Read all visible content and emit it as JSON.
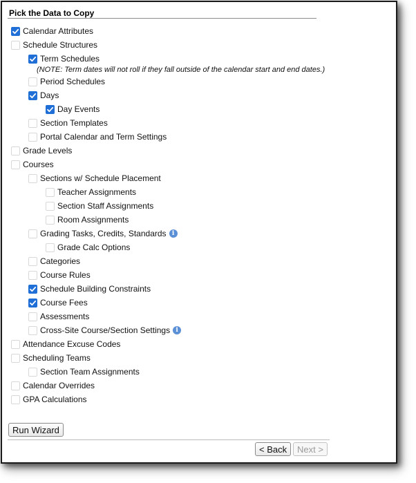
{
  "section_title": "Pick the Data to Copy",
  "items": [
    {
      "label": "Calendar Attributes",
      "checked": true,
      "level": 0
    },
    {
      "label": "Schedule Structures",
      "checked": false,
      "level": 0
    },
    {
      "label": "Term Schedules",
      "checked": true,
      "level": 1
    },
    {
      "label": "Period Schedules",
      "checked": false,
      "level": 1
    },
    {
      "label": "Days",
      "checked": true,
      "level": 1
    },
    {
      "label": "Day Events",
      "checked": true,
      "level": 2
    },
    {
      "label": "Section Templates",
      "checked": false,
      "level": 1
    },
    {
      "label": "Portal Calendar and Term Settings",
      "checked": false,
      "level": 1
    },
    {
      "label": "Grade Levels",
      "checked": false,
      "level": 0
    },
    {
      "label": "Courses",
      "checked": false,
      "level": 0
    },
    {
      "label": "Sections w/ Schedule Placement",
      "checked": false,
      "level": 1
    },
    {
      "label": "Teacher Assignments",
      "checked": false,
      "level": 2
    },
    {
      "label": "Section Staff Assignments",
      "checked": false,
      "level": 2
    },
    {
      "label": "Room Assignments",
      "checked": false,
      "level": 2
    },
    {
      "label": "Grading Tasks, Credits, Standards",
      "checked": false,
      "level": 1,
      "info": true
    },
    {
      "label": "Grade Calc Options",
      "checked": false,
      "level": 2
    },
    {
      "label": "Categories",
      "checked": false,
      "level": 1
    },
    {
      "label": "Course Rules",
      "checked": false,
      "level": 1
    },
    {
      "label": "Schedule Building Constraints",
      "checked": true,
      "level": 1
    },
    {
      "label": "Course Fees",
      "checked": true,
      "level": 1
    },
    {
      "label": "Assessments",
      "checked": false,
      "level": 1
    },
    {
      "label": "Cross-Site Course/Section Settings",
      "checked": false,
      "level": 1,
      "info": true
    },
    {
      "label": "Attendance Excuse Codes",
      "checked": false,
      "level": 0
    },
    {
      "label": "Scheduling Teams",
      "checked": false,
      "level": 0
    },
    {
      "label": "Section Team Assignments",
      "checked": false,
      "level": 1
    },
    {
      "label": "Calendar Overrides",
      "checked": false,
      "level": 0
    },
    {
      "label": "GPA Calculations",
      "checked": false,
      "level": 0
    }
  ],
  "term_note": "(NOTE: Term dates will not roll if they fall outside of the calendar start and end dates.)",
  "buttons": {
    "run_wizard": "Run Wizard",
    "back": "< Back",
    "next": "Next >"
  },
  "info_icon_glyph": "i",
  "colors": {
    "checkbox_checked": "#1f6fd6",
    "info_icon": "#5b8fd6"
  }
}
